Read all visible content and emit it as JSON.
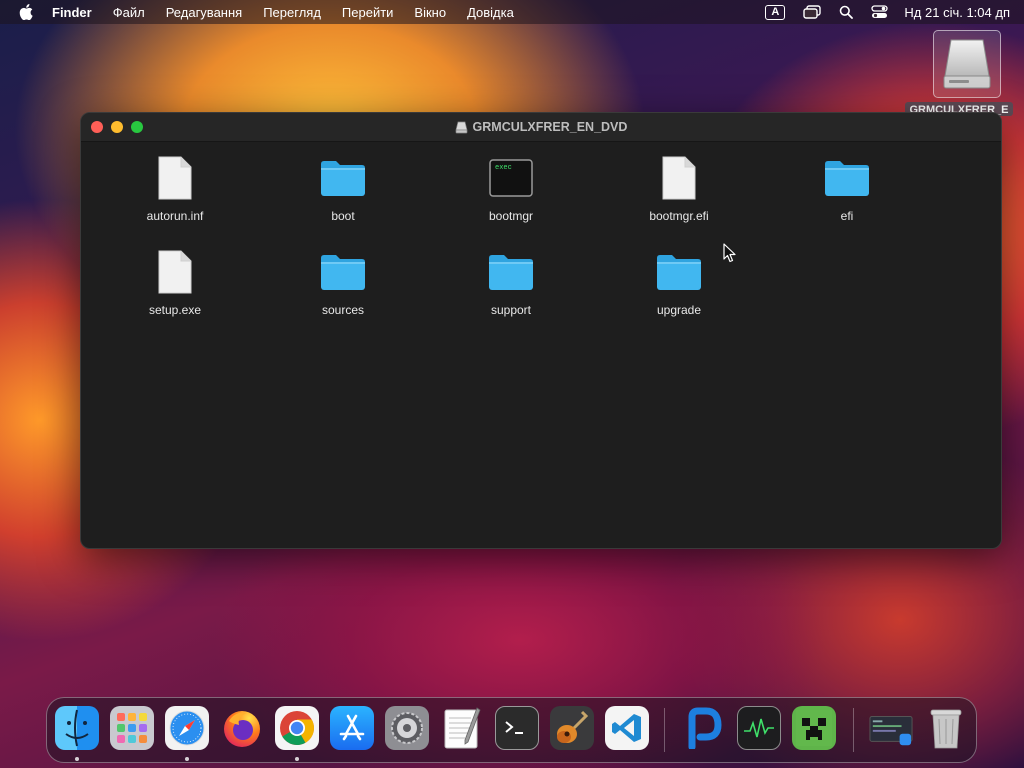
{
  "menubar": {
    "app_name": "Finder",
    "items": [
      "Файл",
      "Редагування",
      "Перегляд",
      "Перейти",
      "Вікно",
      "Довідка"
    ],
    "input_source": "A",
    "clock": "Нд 21 січ.  1:04 дп"
  },
  "desktop": {
    "disk_label": "GRMCULXFRER_E"
  },
  "window": {
    "title": "GRMCULXFRER_EN_DVD",
    "items": [
      {
        "name": "autorun.inf",
        "kind": "document"
      },
      {
        "name": "boot",
        "kind": "folder"
      },
      {
        "name": "bootmgr",
        "kind": "exec"
      },
      {
        "name": "bootmgr.efi",
        "kind": "document"
      },
      {
        "name": "efi",
        "kind": "folder"
      },
      {
        "name": "setup.exe",
        "kind": "document"
      },
      {
        "name": "sources",
        "kind": "folder"
      },
      {
        "name": "support",
        "kind": "folder"
      },
      {
        "name": "upgrade",
        "kind": "folder"
      }
    ],
    "exec_badge": "exec"
  },
  "dock": {
    "apps": [
      {
        "name": "finder",
        "icon": "finder-icon",
        "running": true
      },
      {
        "name": "launchpad",
        "icon": "launchpad-icon",
        "running": false
      },
      {
        "name": "safari",
        "icon": "safari-icon",
        "running": true
      },
      {
        "name": "firefox",
        "icon": "firefox-icon",
        "running": false
      },
      {
        "name": "chrome",
        "icon": "chrome-icon",
        "running": true
      },
      {
        "name": "app-store",
        "icon": "app-store-icon",
        "running": false
      },
      {
        "name": "system-preferences",
        "icon": "gear-icon",
        "running": false
      },
      {
        "name": "textedit",
        "icon": "textedit-icon",
        "running": false
      },
      {
        "name": "terminal",
        "icon": "terminal-icon",
        "running": false
      },
      {
        "name": "garageband",
        "icon": "guitar-icon",
        "running": false
      },
      {
        "name": "vscode",
        "icon": "vscode-icon",
        "running": false
      },
      {
        "name": "dock-app-blue",
        "icon": "blue-d-icon",
        "running": false
      },
      {
        "name": "activity-monitor",
        "icon": "activity-monitor-icon",
        "running": false
      },
      {
        "name": "minecraft",
        "icon": "creeper-icon",
        "running": false
      },
      {
        "name": "window-preview",
        "icon": "window-preview-icon",
        "running": false
      },
      {
        "name": "trash",
        "icon": "trash-icon",
        "running": false
      }
    ]
  },
  "colors": {
    "folder": "#41b7f0",
    "folder_tab": "#2fa4e0",
    "window_bg": "#1e1e1e"
  }
}
